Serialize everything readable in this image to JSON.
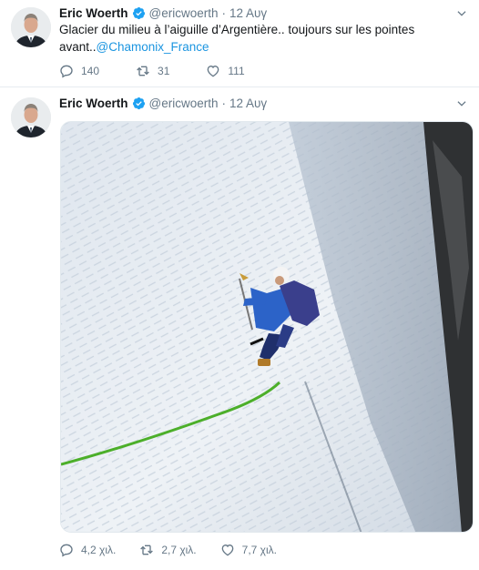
{
  "tweets": [
    {
      "name": "Eric Woerth",
      "handle": "@ericwoerth",
      "separator": "·",
      "date": "12 Αυγ",
      "text": "Glacier du milieu à l’aiguille d’Argentière.. toujours sur les pointes avant..",
      "mention": "@Chamonix_France",
      "replies": "140",
      "retweets": "31",
      "likes": "111"
    },
    {
      "name": "Eric Woerth",
      "handle": "@ericwoerth",
      "separator": "·",
      "date": "12 Αυγ",
      "replies": "4,2 χιλ.",
      "retweets": "2,7 χιλ.",
      "likes": "7,7 χιλ."
    }
  ],
  "colors": {
    "link": "#1b95e0",
    "secondary_text": "#657786",
    "verified": "#1da1f2",
    "border": "#e6ecf0"
  },
  "icons": [
    "verified-badge-icon",
    "chevron-down-icon",
    "reply-icon",
    "retweet-icon",
    "like-icon"
  ]
}
